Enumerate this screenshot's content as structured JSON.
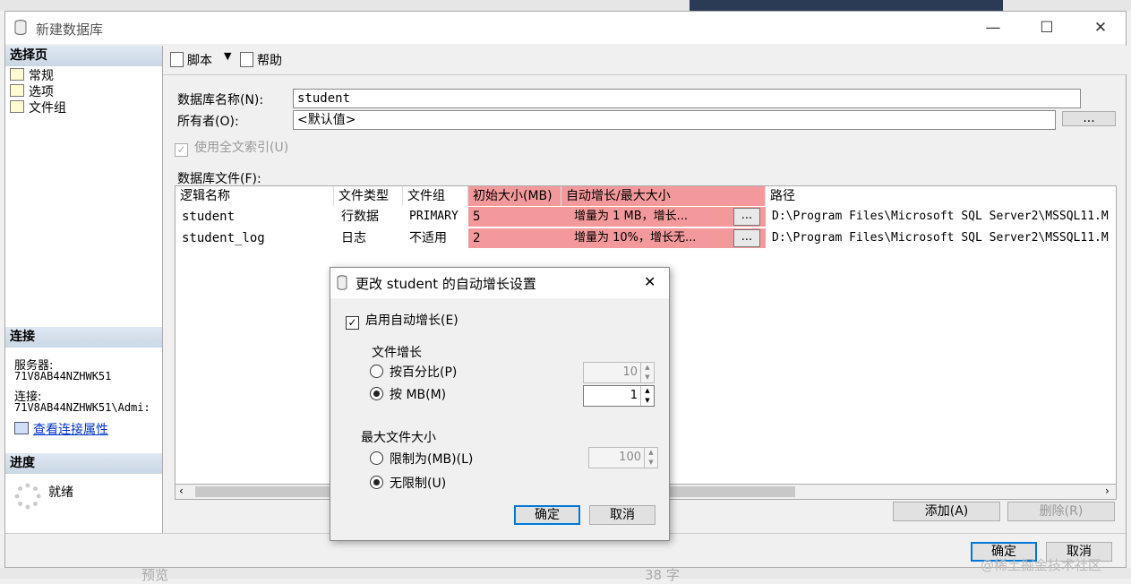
{
  "background": {
    "bottom_text": "预览",
    "bottom_count": "38 字",
    "watermark": "@稀土掘金技术社区"
  },
  "window": {
    "title": "新建数据库",
    "minimize": "—",
    "maximize": "☐",
    "close": "✕"
  },
  "left": {
    "select_page_header": "选择页",
    "nav": [
      "常规",
      "选项",
      "文件组"
    ],
    "connection_header": "连接",
    "server_label": "服务器:",
    "server_value": "71V8AB44NZHWK51",
    "connection_label": "连接:",
    "connection_value": "71V8AB44NZHWK51\\Admi:",
    "view_conn_props": "查看连接属性",
    "progress_header": "进度",
    "progress_status": "就绪"
  },
  "toolbar": {
    "script": "脚本",
    "help": "帮助"
  },
  "form": {
    "db_name_label": "数据库名称(N):",
    "db_name_value": "student",
    "owner_label": "所有者(O):",
    "owner_value": "<默认值>",
    "owner_browse": "...",
    "fulltext_label": "使用全文索引(U)",
    "db_files_label": "数据库文件(F):"
  },
  "grid": {
    "headers": [
      "逻辑名称",
      "文件类型",
      "文件组",
      "初始大小(MB)",
      "自动增长/最大大小",
      "路径"
    ],
    "rows": [
      {
        "name": "student",
        "type": "行数据",
        "group": "PRIMARY",
        "size": "5",
        "growth": "增量为 1 MB，增长...",
        "btn": "...",
        "path": "D:\\Program Files\\Microsoft SQL Server2\\MSSQL11.M"
      },
      {
        "name": "student_log",
        "type": "日志",
        "group": "不适用",
        "size": "2",
        "growth": "增量为 10%，增长无...",
        "btn": "...",
        "path": "D:\\Program Files\\Microsoft SQL Server2\\MSSQL11.M"
      }
    ]
  },
  "buttons": {
    "add": "添加(A)",
    "remove": "删除(R)",
    "ok": "确定",
    "cancel": "取消"
  },
  "dialog": {
    "title": "更改 student 的自动增长设置",
    "close": "✕",
    "enable_autogrowth": "启用自动增长(E)",
    "enable_checked": true,
    "file_growth_label": "文件增长",
    "by_percent": "按百分比(P)",
    "percent_value": "10",
    "by_mb": "按 MB(M)",
    "mb_value": "1",
    "growth_mode": "by_mb",
    "max_size_label": "最大文件大小",
    "limit_to_mb": "限制为(MB)(L)",
    "limit_value": "100",
    "unlimited": "无限制(U)",
    "max_mode": "unlimited",
    "ok": "确定",
    "cancel": "取消"
  },
  "colors": {
    "highlight": "#f4999b",
    "accent": "#0078d7",
    "link": "#0033cc",
    "header_gradient_top": "#dfe8f2",
    "header_gradient_bottom": "#c9d6e4"
  }
}
